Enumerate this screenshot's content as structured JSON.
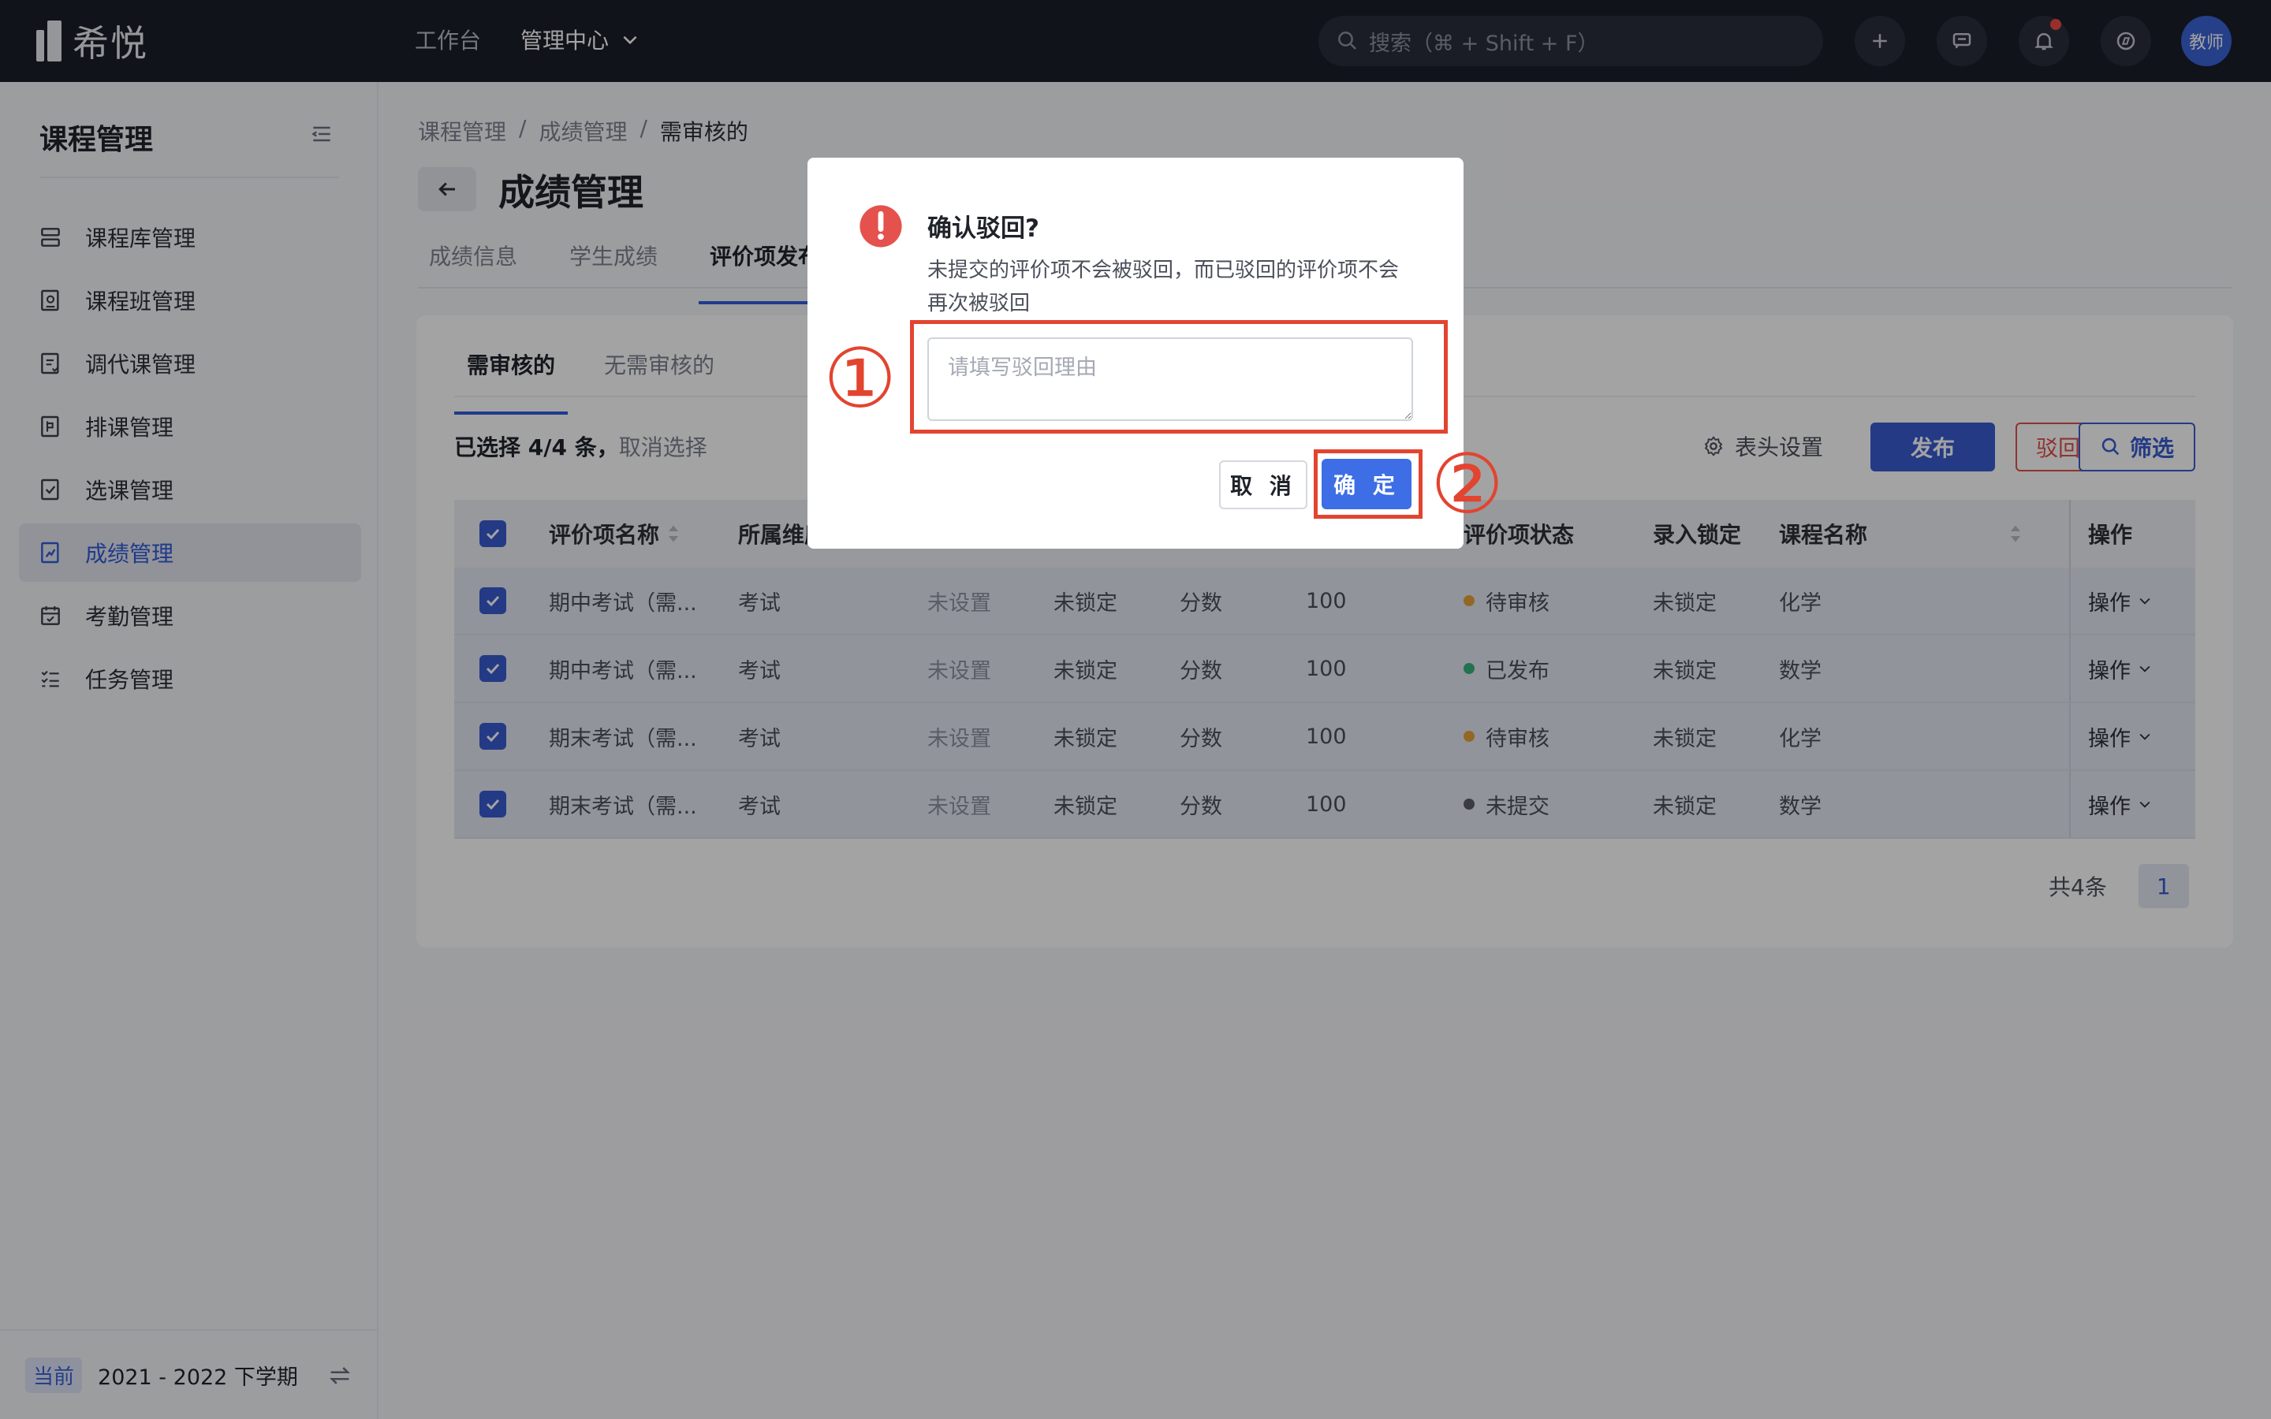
{
  "app": {
    "brand": "希悦"
  },
  "topbar": {
    "nav": [
      {
        "label": "工作台"
      },
      {
        "label": "管理中心"
      }
    ],
    "search_placeholder": "搜索（⌘ + Shift + F）",
    "avatar": "教师"
  },
  "sidebar": {
    "title": "课程管理",
    "items": [
      {
        "label": "课程库管理",
        "icon": "course-library-icon"
      },
      {
        "label": "课程班管理",
        "icon": "class-icon"
      },
      {
        "label": "调代课管理",
        "icon": "substitute-icon"
      },
      {
        "label": "排课管理",
        "icon": "schedule-icon"
      },
      {
        "label": "选课管理",
        "icon": "selection-icon"
      },
      {
        "label": "成绩管理",
        "icon": "grade-icon",
        "active": true
      },
      {
        "label": "考勤管理",
        "icon": "attendance-icon"
      },
      {
        "label": "任务管理",
        "icon": "task-icon"
      }
    ],
    "term_badge": "当前",
    "term": "2021 - 2022 下学期"
  },
  "breadcrumb": [
    "课程管理",
    "成绩管理",
    "需审核的"
  ],
  "page_title": "成绩管理",
  "tabs": [
    "成绩信息",
    "学生成绩",
    "评价项发布"
  ],
  "subtabs": [
    "需审核的",
    "无需审核的"
  ],
  "selection": {
    "text": "已选择 4/4 条，",
    "cancel": "取消选择"
  },
  "toolbar": {
    "header_settings": "表头设置",
    "publish": "发布",
    "reject": "驳回",
    "filter": "筛选"
  },
  "table": {
    "headers": {
      "name": "评价项名称",
      "dimension": "所属维度",
      "status": "评价项状态",
      "lock": "录入锁定",
      "course": "课程名称",
      "ops": "操作"
    },
    "rows": [
      {
        "name": "期中考试（需...",
        "dimension": "考试",
        "c3": "未设置",
        "c4": "未锁定",
        "c5": "分数",
        "c6": "100",
        "status": "待审核",
        "status_color": "#e6a23c",
        "lock": "未锁定",
        "course": "化学",
        "ops": "操作"
      },
      {
        "name": "期中考试（需...",
        "dimension": "考试",
        "c3": "未设置",
        "c4": "未锁定",
        "c5": "分数",
        "c6": "100",
        "status": "已发布",
        "status_color": "#36b37e",
        "lock": "未锁定",
        "course": "数学",
        "ops": "操作"
      },
      {
        "name": "期末考试（需...",
        "dimension": "考试",
        "c3": "未设置",
        "c4": "未锁定",
        "c5": "分数",
        "c6": "100",
        "status": "待审核",
        "status_color": "#e6a23c",
        "lock": "未锁定",
        "course": "化学",
        "ops": "操作"
      },
      {
        "name": "期末考试（需...",
        "dimension": "考试",
        "c3": "未设置",
        "c4": "未锁定",
        "c5": "分数",
        "c6": "100",
        "status": "未提交",
        "status_color": "#5b5f68",
        "lock": "未锁定",
        "course": "数学",
        "ops": "操作"
      }
    ]
  },
  "pager": {
    "total": "共4条",
    "page": "1"
  },
  "modal": {
    "title": "确认驳回?",
    "description": "未提交的评价项不会被驳回，而已驳回的评价项不会再次被驳回",
    "input_placeholder": "请填写驳回理由",
    "cancel": "取 消",
    "confirm": "确 定"
  },
  "annotations": {
    "step1": "①",
    "step2": "②",
    "color": "#e2442f"
  }
}
